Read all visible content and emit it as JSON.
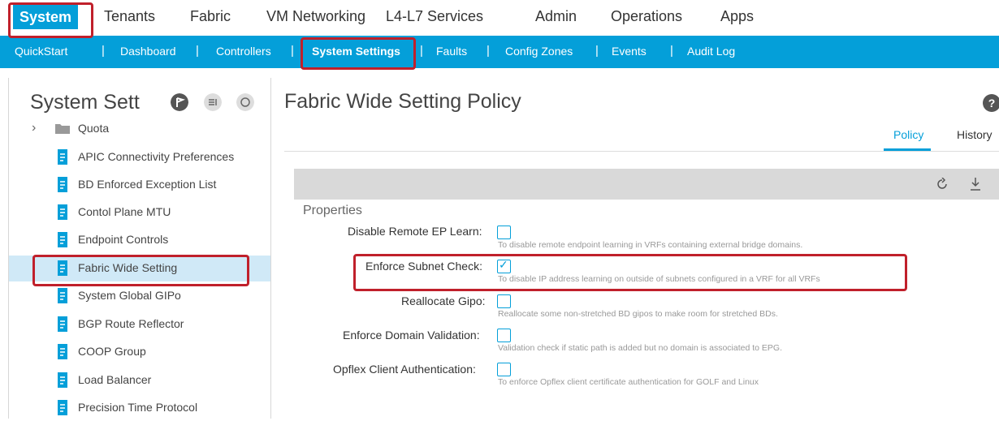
{
  "top_nav": {
    "items": [
      "System",
      "Tenants",
      "Fabric",
      "VM Networking",
      "L4-L7 Services",
      "Admin",
      "Operations",
      "Apps"
    ]
  },
  "sub_nav": {
    "items": [
      "QuickStart",
      "Dashboard",
      "Controllers",
      "System Settings",
      "Faults",
      "Config Zones",
      "Events",
      "Audit Log"
    ],
    "separator": "|"
  },
  "left_panel": {
    "title": "System Sett",
    "tree": [
      {
        "label": "Quota",
        "type": "folder"
      },
      {
        "label": "APIC Connectivity Preferences",
        "type": "policy"
      },
      {
        "label": "BD Enforced Exception List",
        "type": "policy"
      },
      {
        "label": "Contol Plane MTU",
        "type": "policy"
      },
      {
        "label": "Endpoint Controls",
        "type": "policy"
      },
      {
        "label": "Fabric Wide Setting",
        "type": "policy"
      },
      {
        "label": "System Global GIPo",
        "type": "policy"
      },
      {
        "label": "BGP Route Reflector",
        "type": "policy"
      },
      {
        "label": "COOP Group",
        "type": "policy"
      },
      {
        "label": "Load Balancer",
        "type": "policy"
      },
      {
        "label": "Precision Time Protocol",
        "type": "policy"
      }
    ]
  },
  "main": {
    "title": "Fabric Wide Setting Policy",
    "tabs": [
      "Policy",
      "History"
    ],
    "section_title": "Properties",
    "properties": [
      {
        "label": "Disable Remote EP Learn:",
        "checked": false,
        "desc": "To disable remote endpoint learning in VRFs containing external bridge domains."
      },
      {
        "label": "Enforce Subnet Check:",
        "checked": true,
        "desc": "To disable IP address learning on outside of subnets configured in a VRF for all VRFs"
      },
      {
        "label": "Reallocate Gipo:",
        "checked": false,
        "desc": "Reallocate some non-stretched BD gipos to make room for stretched BDs."
      },
      {
        "label": "Enforce Domain Validation:",
        "checked": false,
        "desc": "Validation check if static path is added but no domain is associated to EPG."
      },
      {
        "label": "Opflex Client Authentication:",
        "checked": false,
        "desc": "To enforce Opflex client certificate authentication for GOLF and Linux"
      }
    ],
    "help_glyph": "?"
  },
  "colors": {
    "accent": "#049fd9",
    "highlight": "#c0202b",
    "selected_row": "#d0e9f7",
    "toolbar": "#d9d9d9"
  }
}
